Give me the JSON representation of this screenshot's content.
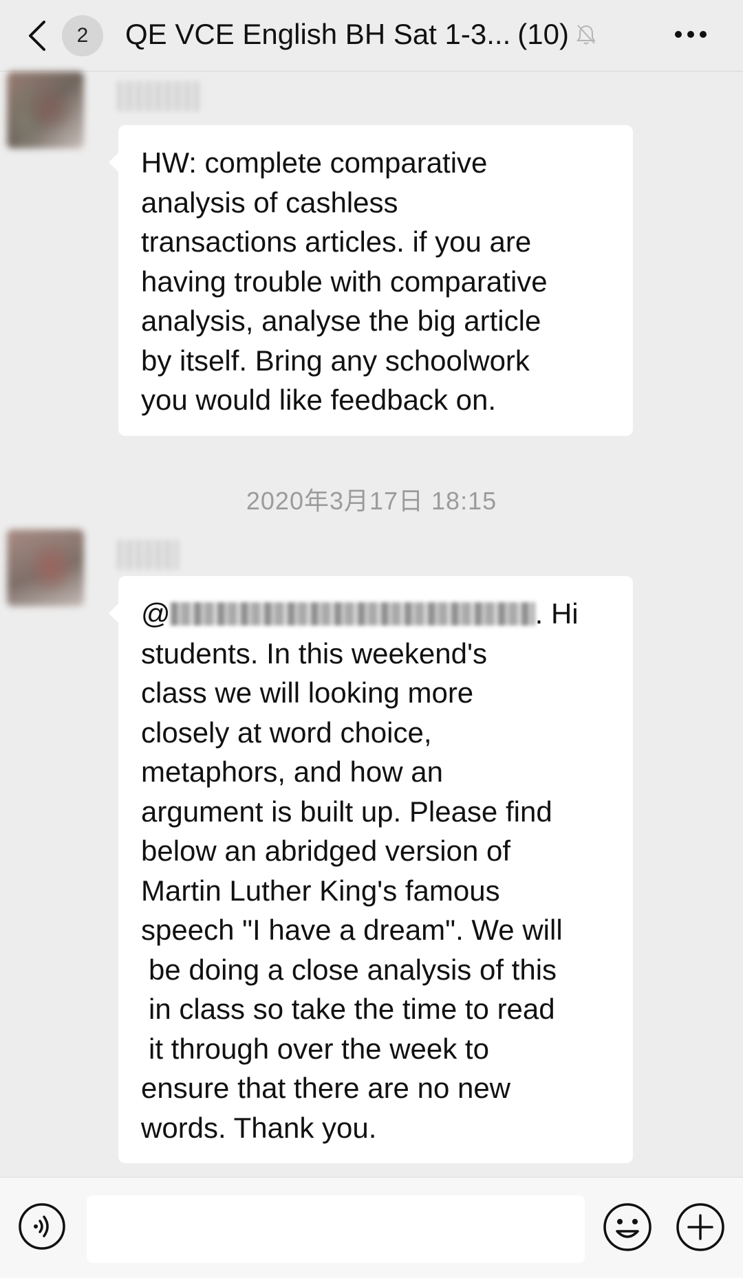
{
  "header": {
    "unread_count": "2",
    "title": "QE VCE English BH Sat 1-3...",
    "member_count": "(10)",
    "icons": {
      "back": "chevron-left-icon",
      "mute": "bell-muted-icon",
      "more": "more-horizontal-icon"
    }
  },
  "messages": [
    {
      "lines": [
        "HW: complete comparative",
        "analysis of cashless",
        "transactions articles. if you are",
        "having trouble with comparative",
        "analysis, analyse the big article",
        "by itself. Bring any schoolwork",
        "you would like feedback on."
      ]
    },
    {
      "mention_prefix": "@",
      "mention_suffix": ". Hi",
      "lines": [
        "students. In this weekend's",
        "class we will looking more",
        "closely at word choice,",
        "metaphors, and how an",
        "argument is built up. Please find",
        "below an abridged version of",
        "Martin Luther King's famous",
        "speech \"I have a dream\". We will",
        "be doing a close analysis of this",
        "in class so take the time to read",
        "it through over the week to",
        "ensure that there are no new",
        "words. Thank you."
      ]
    }
  ],
  "timestamp": "2020年3月17日 18:15",
  "input_bar": {
    "text_value": "",
    "icons": {
      "voice": "voice-input-icon",
      "emoji": "emoji-icon",
      "plus": "plus-circle-icon"
    }
  }
}
